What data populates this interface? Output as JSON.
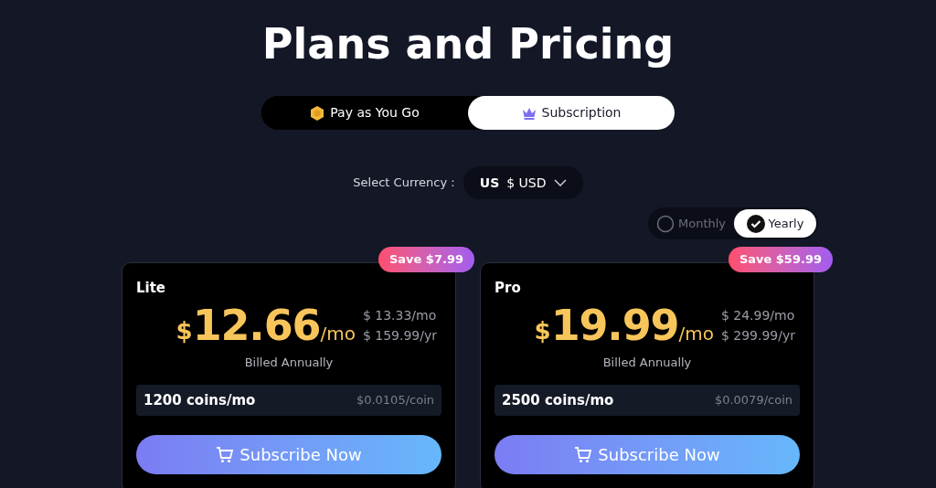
{
  "title": "Plans and Pricing",
  "tabs": [
    {
      "label": "Pay as You Go",
      "kind": "coin",
      "selected": false
    },
    {
      "label": "Subscription",
      "kind": "crown",
      "selected": true
    }
  ],
  "currency": {
    "label": "Select Currency :",
    "region": "US",
    "value": "$ USD"
  },
  "billing": [
    {
      "label": "Monthly",
      "selected": false
    },
    {
      "label": "Yearly",
      "selected": true
    }
  ],
  "plans": [
    {
      "name": "Lite",
      "badge": "Save $7.99",
      "currency_symbol": "$",
      "price": "12.66",
      "unit": "/mo",
      "old_monthly": "$ 13.33/mo",
      "old_yearly": "$ 159.99/yr",
      "billing_note": "Billed Annually",
      "coins": "1200 coins/mo",
      "per_coin": "$0.0105/coin",
      "button": "Subscribe Now"
    },
    {
      "name": "Pro",
      "badge": "Save $59.99",
      "currency_symbol": "$",
      "price": "19.99",
      "unit": "/mo",
      "old_monthly": "$ 24.99/mo",
      "old_yearly": "$ 299.99/yr",
      "billing_note": "Billed Annually",
      "coins": "2500 coins/mo",
      "per_coin": "$0.0079/coin",
      "button": "Subscribe Now"
    }
  ]
}
